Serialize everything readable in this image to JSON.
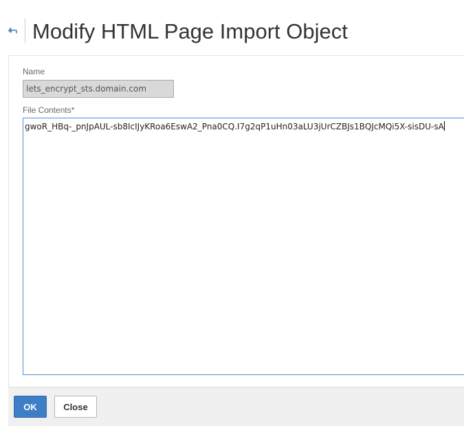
{
  "header": {
    "title": "Modify HTML Page Import Object",
    "back_icon": "back-arrow-icon"
  },
  "form": {
    "name_label": "Name",
    "name_value": "lets_encrypt_sts.domain.com",
    "contents_label": "File Contents*",
    "contents_value": "gwoR_HBq-_pnJpAUL-sb8IcIJyKRoa6EswA2_Pna0CQ.I7g2qP1uHn03aLU3jUrCZBJs1BQJcMQi5X-sisDU-sA"
  },
  "footer": {
    "ok_label": "OK",
    "close_label": "Close"
  },
  "colors": {
    "accent": "#3d7ec6",
    "textarea_border": "#4a90d9",
    "readonly_bg": "#d9d9d9"
  }
}
